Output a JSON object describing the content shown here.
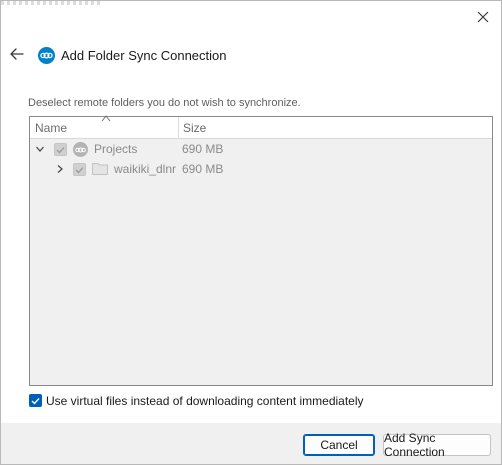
{
  "window": {
    "title": "Add Folder Sync Connection"
  },
  "dialog": {
    "instruction": "Deselect remote folders you do not wish to synchronize."
  },
  "tree": {
    "columns": {
      "name": "Name",
      "size": "Size"
    },
    "rows": [
      {
        "name": "Projects",
        "size": "690 MB",
        "expanded": true,
        "checked": true,
        "icon": "nextcloud-icon"
      },
      {
        "name": "waikiki_dlnr",
        "size": "690 MB",
        "expanded": false,
        "checked": true,
        "icon": "folder-icon"
      }
    ]
  },
  "options": {
    "virtual_files_label": "Use virtual files instead of downloading content immediately",
    "virtual_files_checked": true
  },
  "buttons": {
    "cancel": "Cancel",
    "add": "Add Sync Connection"
  },
  "colors": {
    "accent": "#0082c9",
    "checkbox_blue": "#005fb8"
  }
}
